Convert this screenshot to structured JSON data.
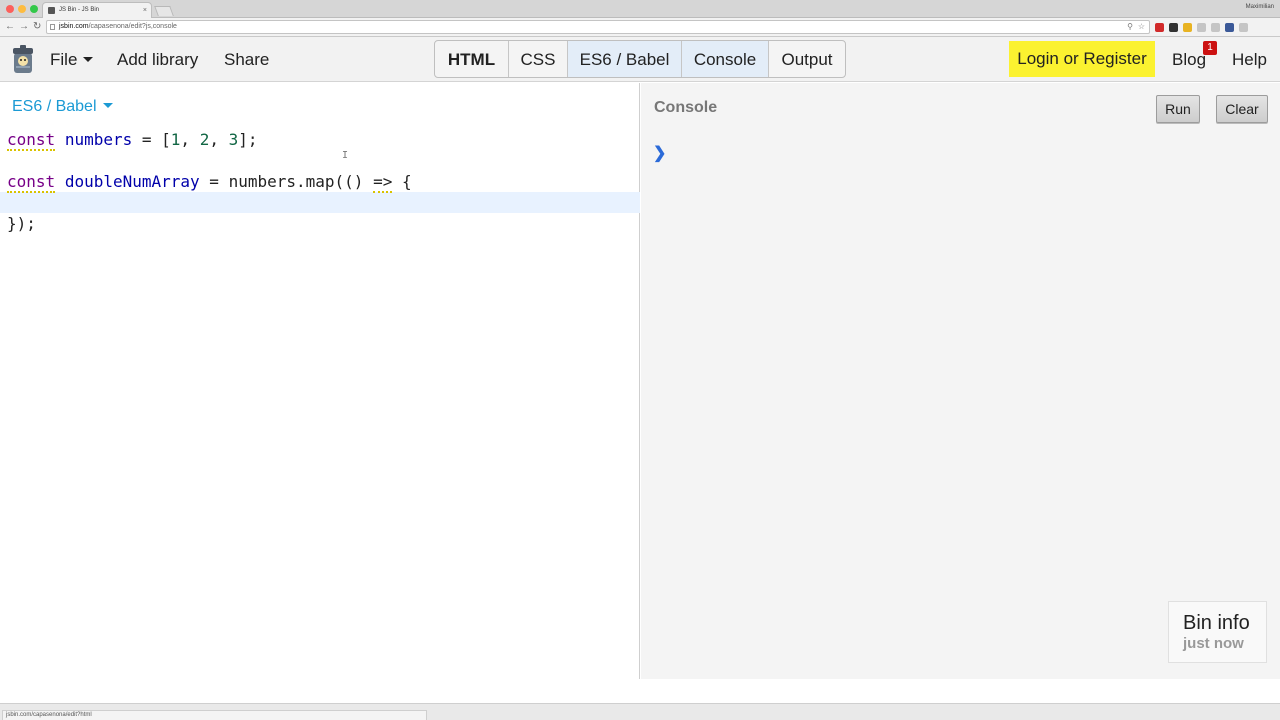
{
  "browser": {
    "tab_title": "JS Bin - JS Bin",
    "tab_close": "×",
    "profile_name": "Maximilian",
    "url_host": "jsbin.com",
    "url_path": "/capasenona/edit?js,console",
    "nav": {
      "back": "←",
      "forward": "→",
      "reload": "↻"
    },
    "zoom_icon": "⚲",
    "star_icon": "☆",
    "extension_colors": [
      "#d12a2a",
      "#333333",
      "#e8b322",
      "#c5c5c5",
      "#c5c5c5",
      "#3b5998",
      "#c5c5c5"
    ]
  },
  "toolbar": {
    "file": "File",
    "add_library": "Add library",
    "share": "Share",
    "login": "Login or Register",
    "blog": "Blog",
    "blog_badge": "1",
    "help": "Help"
  },
  "panels": [
    {
      "label": "HTML",
      "active": false,
      "bold": true,
      "width": 74
    },
    {
      "label": "CSS",
      "active": false,
      "bold": false,
      "width": 59
    },
    {
      "label": "ES6 / Babel",
      "active": true,
      "bold": false,
      "width": 114
    },
    {
      "label": "Console",
      "active": true,
      "bold": false,
      "width": 87
    },
    {
      "label": "Output",
      "active": false,
      "bold": false,
      "width": 76
    }
  ],
  "editor": {
    "language": "ES6 / Babel",
    "code": {
      "line1": {
        "kw": "const",
        "var": "numbers",
        "op": " = [",
        "n1": "1",
        "c1": ", ",
        "n2": "2",
        "c2": ", ",
        "n3": "3",
        "end": "];"
      },
      "line2": {
        "kw": "const",
        "var": "doubleNumArray",
        "rest1": " = numbers.map(() ",
        "arrow": "=>",
        "rest2": " {"
      },
      "line4": "});"
    },
    "cursor_glyph": "I"
  },
  "console": {
    "title": "Console",
    "run": "Run",
    "clear": "Clear",
    "prompt": "❯"
  },
  "bin_info": {
    "title": "Bin info",
    "time": "just now"
  },
  "status": {
    "url": "jsbin.com/capasenona/edit?html"
  }
}
